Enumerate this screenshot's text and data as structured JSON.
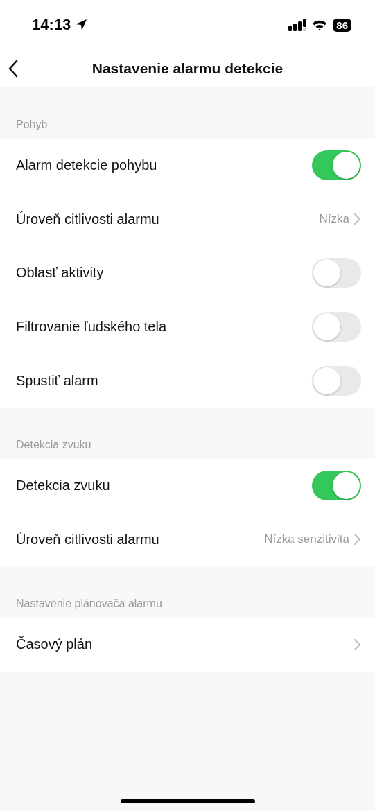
{
  "status_bar": {
    "time": "14:13",
    "battery": "86"
  },
  "nav": {
    "title": "Nastavenie alarmu detekcie"
  },
  "sections": [
    {
      "header": "Pohyb",
      "rows": [
        {
          "kind": "toggle",
          "label": "Alarm detekcie pohybu",
          "on": true
        },
        {
          "kind": "link",
          "label": "Úroveň citlivosti alarmu",
          "value": "Nízka"
        },
        {
          "kind": "toggle",
          "label": "Oblasť aktivity",
          "on": false
        },
        {
          "kind": "toggle",
          "label": "Filtrovanie ľudského tela",
          "on": false
        },
        {
          "kind": "toggle",
          "label": "Spustiť alarm",
          "on": false
        }
      ]
    },
    {
      "header": "Detekcia zvuku",
      "rows": [
        {
          "kind": "toggle",
          "label": "Detekcia zvuku",
          "on": true
        },
        {
          "kind": "link",
          "label": "Úroveň citlivosti alarmu",
          "value": "Nízka senzitivita"
        }
      ]
    },
    {
      "header": "Nastavenie plánovača alarmu",
      "rows": [
        {
          "kind": "link",
          "label": "Časový plán"
        }
      ]
    }
  ]
}
